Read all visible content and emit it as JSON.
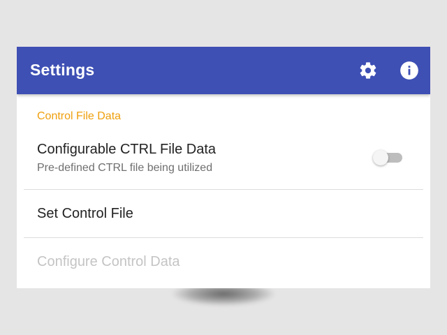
{
  "app_bar": {
    "title": "Settings",
    "background_color": "#3e50b4",
    "actions": [
      {
        "icon": "gear-icon"
      },
      {
        "icon": "info-icon"
      }
    ]
  },
  "section": {
    "header": "Control File Data",
    "header_color": "#ef9f0c"
  },
  "preferences": {
    "ctrl_file_data": {
      "title": "Configurable CTRL File Data",
      "summary": "Pre-defined CTRL file being utilized",
      "switch_on": false
    },
    "set_control_file": {
      "title": "Set Control File"
    },
    "configure_control_data": {
      "title": "Configure Control Data",
      "enabled": false
    }
  }
}
